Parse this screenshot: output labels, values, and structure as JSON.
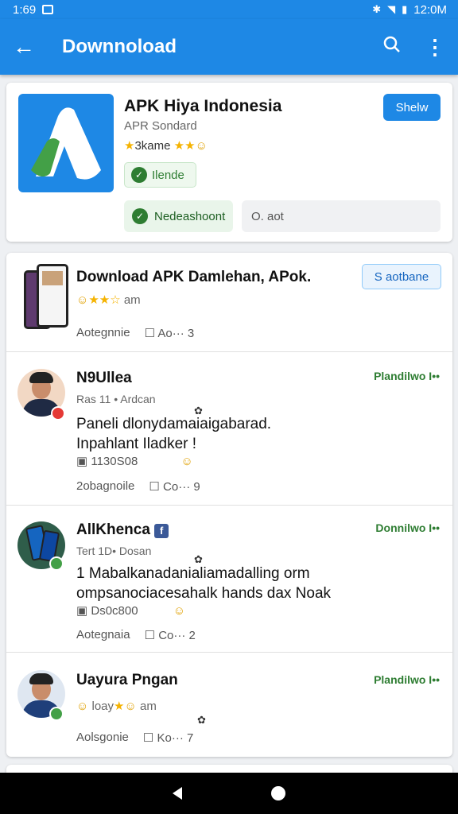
{
  "status_bar": {
    "time": "1:69",
    "clock": "12:0M"
  },
  "app_bar": {
    "title": "Downnoload"
  },
  "app_card": {
    "name": "APK Hiya Indonesia",
    "subtitle": "APR Sondard",
    "rating_text": "3kame",
    "verified_label": "Ilende",
    "share_label": "Shelw",
    "chip_green_label": "Nedeashoont",
    "chip_grey_label": "O. aot"
  },
  "feed": {
    "promo": {
      "title": "Download APK Damlehan, APok.",
      "rating_text": "am",
      "category": "Aotegnnie",
      "comments": "Ao··· 3",
      "button_label": "S aotbane"
    },
    "posts": [
      {
        "author": "N9Ullea",
        "sub": "Ras 11 • Ardcan",
        "body": "Paneli dlonydamaiaigabarad. Inpahlant Iladker !",
        "meta": "1130S08",
        "category": "2obagnoile",
        "comments": "Co··· 9",
        "tag": "Plandilwo I••"
      },
      {
        "author": "AllKhenca",
        "sub": "Tert 1D• Dosan",
        "body": "1 Mabalkanadanialiamadalling orm ompsanociacesahalk hands dax Noak",
        "meta": "Ds0c800",
        "category": "Aotegnaia",
        "comments": "Co··· 2",
        "tag": "Donnilwo I••"
      },
      {
        "author": "Uayura Pngan",
        "sub": "am",
        "rating_text": "loay",
        "category": "Aolsgonie",
        "comments": "Ko··· 7",
        "tag": "Plandilwo I••"
      }
    ]
  },
  "icons": [
    "back-arrow-icon",
    "search-icon",
    "more-vert-icon",
    "star-icon",
    "check-icon",
    "comment-icon",
    "image-icon",
    "facebook-icon"
  ],
  "colors": {
    "primary": "#1e88e5",
    "accent_green": "#2e7d32",
    "star": "#f5b301"
  }
}
